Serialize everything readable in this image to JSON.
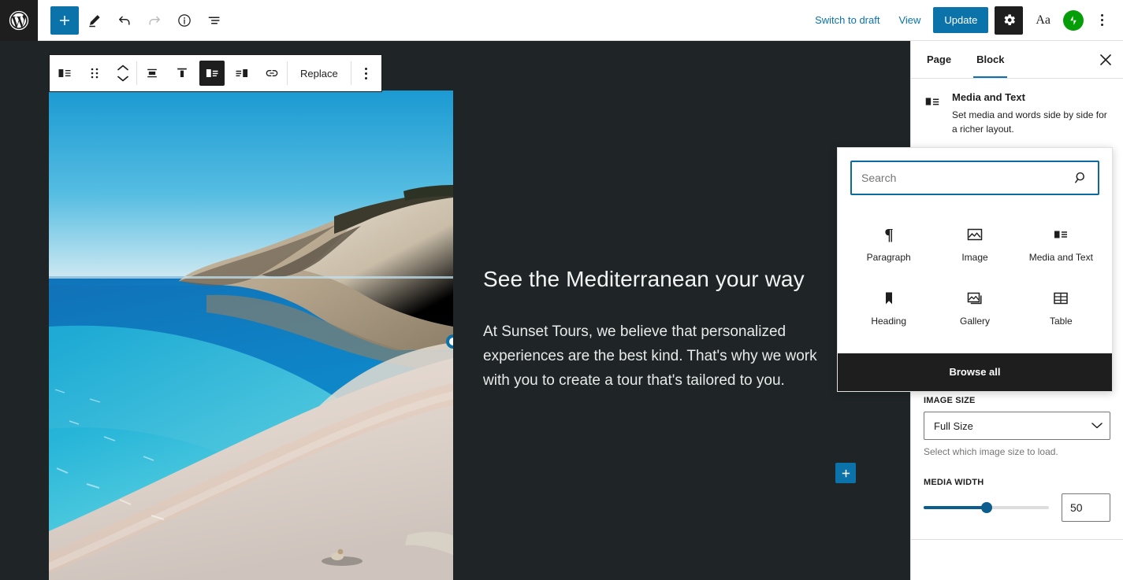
{
  "topbar": {
    "logo_icon": "wordpress-icon",
    "left_tools": [
      {
        "name": "add-block-button",
        "icon": "plus-icon",
        "variant": "primary"
      },
      {
        "name": "edit-tool-button",
        "icon": "pencil-icon",
        "variant": "default"
      },
      {
        "name": "undo-button",
        "icon": "undo-icon",
        "variant": "default"
      },
      {
        "name": "redo-button",
        "icon": "redo-icon",
        "variant": "disabled"
      },
      {
        "name": "details-button",
        "icon": "info-icon",
        "variant": "default"
      },
      {
        "name": "list-view-button",
        "icon": "list-view-icon",
        "variant": "default"
      }
    ],
    "switch_to_draft": "Switch to draft",
    "view": "View",
    "update": "Update",
    "settings_icon": "gear-icon",
    "typography_label": "Aa",
    "jetpack_icon": "jetpack-icon",
    "options_icon": "kebab-menu-icon"
  },
  "block_toolbar": {
    "block_type_icon": "media-and-text-icon",
    "drag_icon": "drag-handle-icon",
    "move_up_icon": "chevron-up-icon",
    "move_down_icon": "chevron-down-icon",
    "align_icons": [
      {
        "name": "align-change-button",
        "icon": "align-center-icon",
        "active": false
      },
      {
        "name": "vertical-align-top-button",
        "icon": "vertical-align-top-icon",
        "active": false
      },
      {
        "name": "show-media-left-button",
        "icon": "media-left-icon",
        "active": true
      },
      {
        "name": "show-media-right-button",
        "icon": "media-right-icon",
        "active": false
      },
      {
        "name": "link-button",
        "icon": "link-icon",
        "active": false
      }
    ],
    "replace_label": "Replace",
    "more_options_icon": "kebab-menu-icon"
  },
  "canvas": {
    "heading": "See the Mediterranean your way",
    "paragraph": "At Sunset Tours, we believe that personalized experiences are the best kind. That's why we work with you to create a tour that's tailored to you.",
    "image_alt": "beach-photo-mediterranean-cove",
    "resize_handle_name": "media-resize-handle",
    "inserter_icon": "plus-icon",
    "background_color": "#1f2527"
  },
  "sidebar": {
    "tabs": [
      {
        "label": "Page",
        "active": false
      },
      {
        "label": "Block",
        "active": true
      }
    ],
    "close_icon": "close-icon",
    "block_card": {
      "icon": "media-and-text-icon",
      "title": "Media and Text",
      "description": "Set media and words side by side for a richer layout."
    },
    "image_size": {
      "label": "IMAGE SIZE",
      "value": "Full Size",
      "options": [
        "Full Size"
      ],
      "help": "Select which image size to load."
    },
    "media_width": {
      "label": "MEDIA WIDTH",
      "value": "50",
      "percent": 50,
      "accent": "#0b5d8e"
    }
  },
  "inserter": {
    "search_placeholder": "Search",
    "search_value": "",
    "search_icon": "search-icon",
    "blocks": [
      {
        "label": "Paragraph",
        "icon": "paragraph-icon"
      },
      {
        "label": "Image",
        "icon": "image-icon"
      },
      {
        "label": "Media and Text",
        "icon": "media-and-text-icon"
      },
      {
        "label": "Heading",
        "icon": "heading-icon"
      },
      {
        "label": "Gallery",
        "icon": "gallery-icon"
      },
      {
        "label": "Table",
        "icon": "table-icon"
      }
    ],
    "browse_all": "Browse all"
  },
  "colors": {
    "accent_blue": "#0b73aa",
    "dark": "#1e1e1e",
    "canvas_bg": "#1f2527",
    "jetpack_green": "#069e08"
  }
}
